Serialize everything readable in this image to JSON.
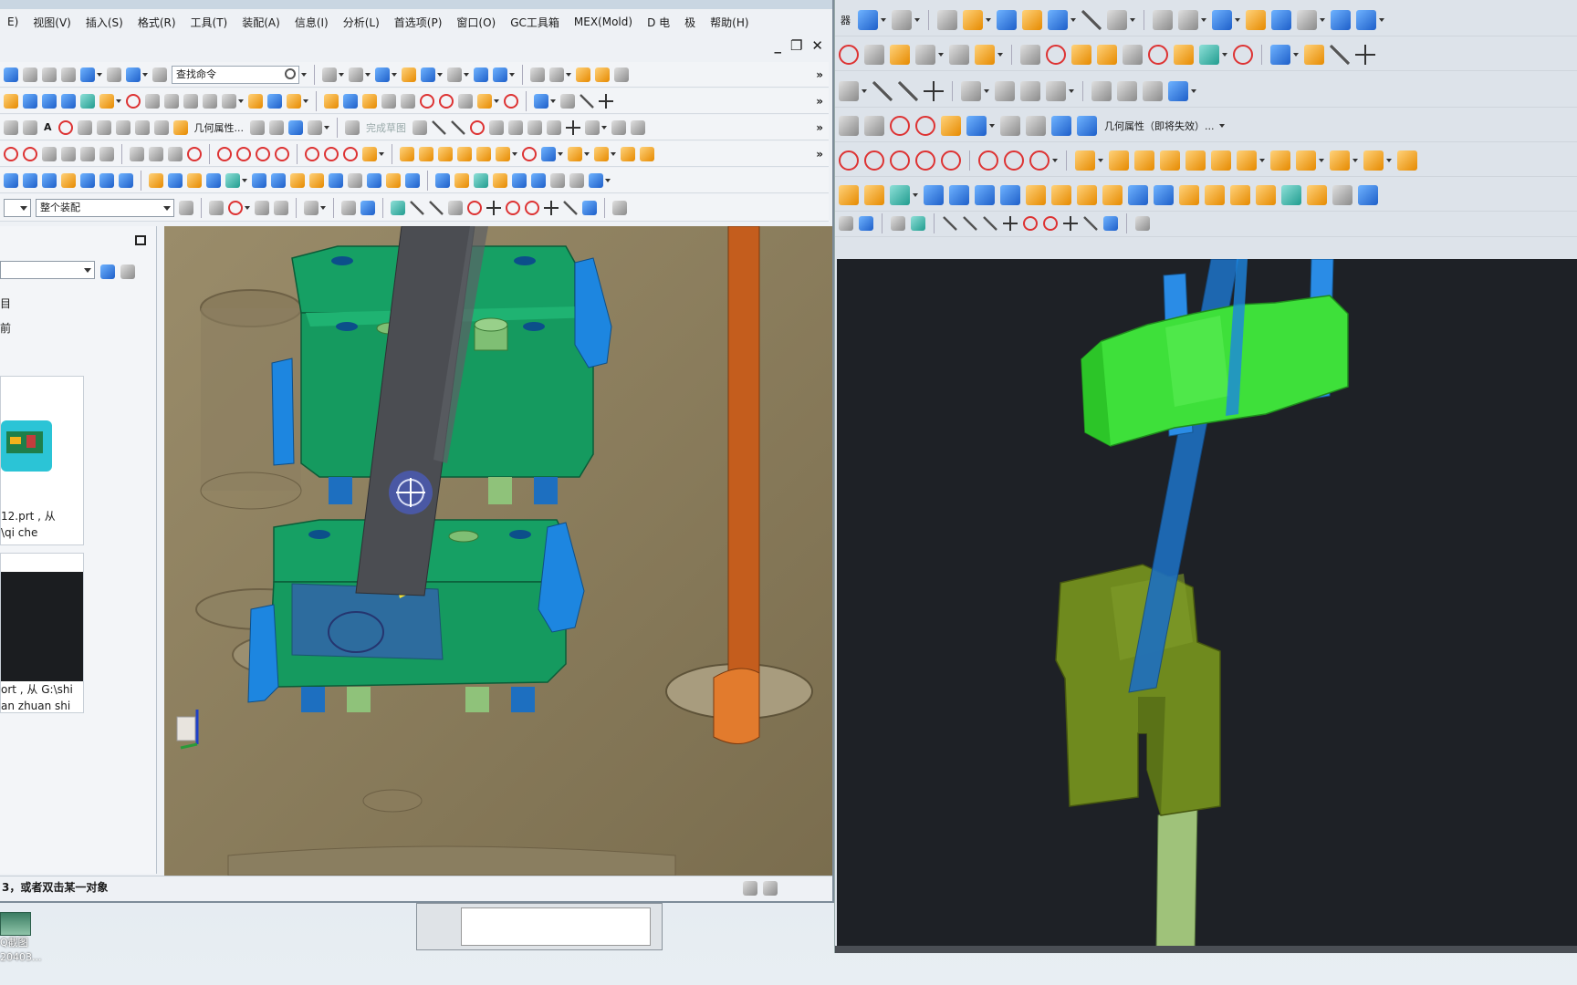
{
  "front_window": {
    "menu": [
      {
        "label": "E)"
      },
      {
        "label": "视图(V)"
      },
      {
        "label": "插入(S)"
      },
      {
        "label": "格式(R)"
      },
      {
        "label": "工具(T)"
      },
      {
        "label": "装配(A)"
      },
      {
        "label": "信息(I)"
      },
      {
        "label": "分析(L)"
      },
      {
        "label": "首选项(P)"
      },
      {
        "label": "窗口(O)"
      },
      {
        "label": "GC工具箱"
      },
      {
        "label": "MEX(Mold)"
      },
      {
        "label": "D 电"
      },
      {
        "label": "极"
      },
      {
        "label": "帮助(H)"
      }
    ],
    "window_controls": {
      "minimize": "_",
      "restore": "❐",
      "close": "✕"
    },
    "toolbar": {
      "search_placeholder": "查找命令",
      "geometry_properties": "几何属性...",
      "dim_label": "完成草图",
      "more_glyph": "»"
    },
    "selection_bar": {
      "filter_value": "",
      "assembly_scope": "整个装配"
    },
    "nav_panel": {
      "tree_items": [
        "目",
        "前"
      ],
      "recent_1": {
        "line1": "12.prt , 从",
        "line2": "\\qi che"
      },
      "recent_2": {
        "line1": "ort , 从 G:\\shi",
        "line2": "an zhuan shi"
      }
    },
    "status_text": "3，或者双击某一对象"
  },
  "back_window": {
    "first_icon_label": "器",
    "geometry_properties": "几何属性（即将失效）..."
  },
  "desktop": {
    "icon_label_1": "Q截图",
    "icon_label_2": "20403..."
  },
  "colors": {
    "viewport_bg": "#8e8060",
    "back_viewport_bg": "#1e2126",
    "mold_green": "#16a064",
    "slider_blue": "#1d86e0",
    "light_green": "#3ee03a",
    "olive": "#6f8a1e"
  }
}
